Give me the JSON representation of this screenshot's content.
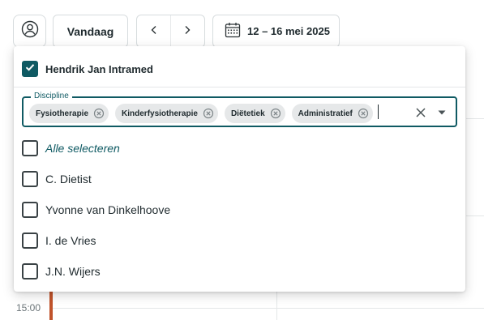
{
  "toolbar": {
    "avatar_icon": "user-circle-icon",
    "today_label": "Vandaag",
    "prev_icon": "chevron-left-icon",
    "next_icon": "chevron-right-icon",
    "calendar_icon": "calendar-icon",
    "date_range": "12 – 16 mei 2025"
  },
  "calendar": {
    "time_label": "15:00",
    "event_color": "#c0532b"
  },
  "panel": {
    "owner": {
      "label": "Hendrik Jan Intramed",
      "checked": true
    },
    "discipline": {
      "legend": "Discipline",
      "chips": [
        "Fysiotherapie",
        "Kinderfysiotherapie",
        "Diëtetiek",
        "Administratief"
      ]
    },
    "select_all_label": "Alle selecteren",
    "options": [
      {
        "label": "C. Dietist",
        "checked": false
      },
      {
        "label": "Yvonne van Dinkelhoove",
        "checked": false
      },
      {
        "label": "I. de Vries",
        "checked": false
      },
      {
        "label": "J.N. Wijers",
        "checked": false
      }
    ]
  },
  "colors": {
    "accent": "#0f5a63",
    "chip_bg": "#e6e8e9",
    "border": "#d7dcde"
  }
}
